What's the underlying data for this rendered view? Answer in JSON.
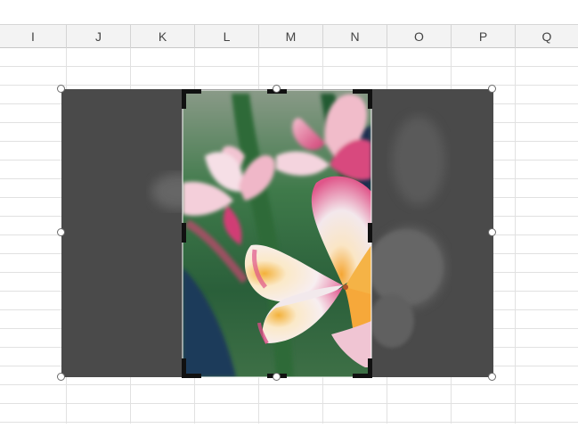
{
  "columns": [
    {
      "label": "I"
    },
    {
      "label": "J"
    },
    {
      "label": "K"
    },
    {
      "label": "L"
    },
    {
      "label": "M"
    },
    {
      "label": "N"
    },
    {
      "label": "O"
    },
    {
      "label": "P"
    },
    {
      "label": "Q"
    }
  ],
  "picture": {
    "subject": "pink plumeria flower photo",
    "colors": {
      "outside_crop_dim": "#4a4a4a",
      "leaf_green": "#2f6b3a",
      "petal_pink": "#e0568a",
      "petal_white": "#f6eef0",
      "petal_yellow": "#f3b13a",
      "shadow_blue": "#1e2f4f"
    }
  },
  "selection": {
    "handle_color": "#6b6b6b",
    "crop_mark_color": "#111111"
  }
}
